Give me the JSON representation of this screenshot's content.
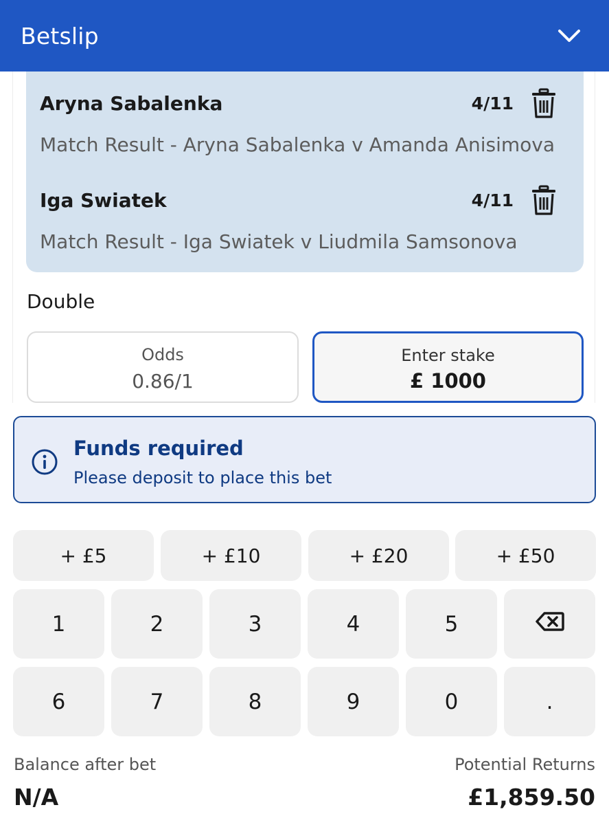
{
  "header": {
    "title": "Betslip",
    "collapse_icon": "chevron-down-icon",
    "color": "#1f57c3"
  },
  "selections": [
    {
      "name": "Aryna Sabalenka",
      "odds": "4/11",
      "market": "Match Result - Aryna Sabalenka v Amanda Anisimova",
      "remove_icon": "trash-icon"
    },
    {
      "name": "Iga Swiatek",
      "odds": "4/11",
      "market": "Match Result - Iga Swiatek v Liudmila Samsonova",
      "remove_icon": "trash-icon"
    }
  ],
  "bet": {
    "type": "Double",
    "odds_label": "Odds",
    "odds_value": "0.86/1",
    "stake_label": "Enter stake",
    "stake_value": "£ 1000"
  },
  "alert": {
    "icon": "info-icon",
    "title": "Funds required",
    "message": "Please deposit to place this bet",
    "color": "#0f3a82"
  },
  "keypad": {
    "quick_stakes": [
      "+ £5",
      "+ £10",
      "+ £20",
      "+ £50"
    ],
    "row1": [
      "1",
      "2",
      "3",
      "4",
      "5"
    ],
    "row2": [
      "6",
      "7",
      "8",
      "9",
      "0",
      "."
    ],
    "backspace_icon": "backspace-icon"
  },
  "footer": {
    "balance_label": "Balance after bet",
    "balance_value": "N/A",
    "returns_label": "Potential Returns",
    "returns_value": "£1,859.50"
  }
}
